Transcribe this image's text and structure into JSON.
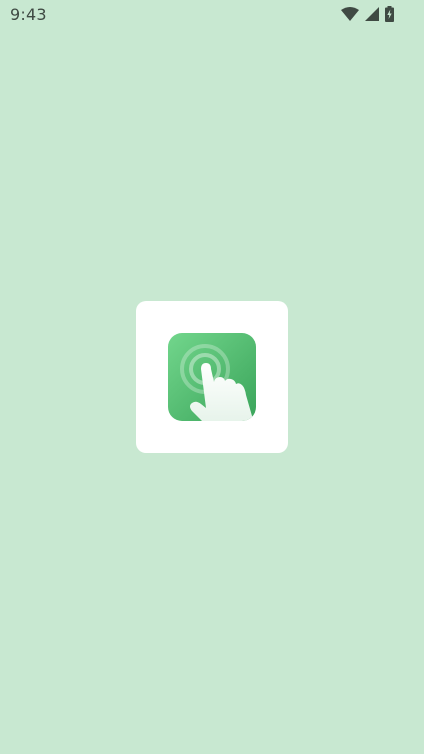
{
  "status_bar": {
    "time": "9:43",
    "icons": [
      "wifi-icon",
      "cellular-signal-icon",
      "battery-charging-icon"
    ]
  },
  "splash": {
    "app_icon": "tap-hand-icon",
    "card_color": "#ffffff",
    "background_color": "#c8e8d1",
    "icon_gradient": [
      "#6fd58a",
      "#3da85c"
    ]
  }
}
